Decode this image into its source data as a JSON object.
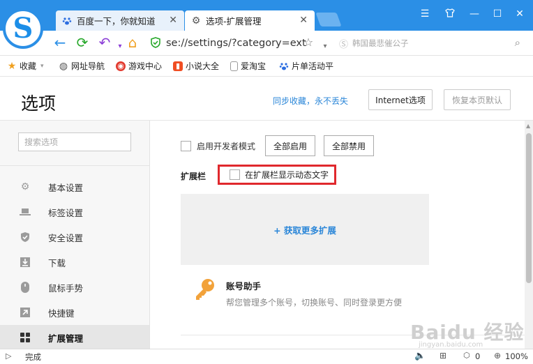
{
  "browser": {
    "logo_glyph": "S",
    "tabs": [
      {
        "label": "百度一下，你就知道",
        "icon": "paw-icon",
        "active": false
      },
      {
        "label": "选项-扩展管理",
        "icon": "gear-icon",
        "active": true
      }
    ],
    "address": "se://settings/?category=ext",
    "search_placeholder": "韩国最悲催公子",
    "bookmarks": [
      {
        "label": "收藏",
        "icon": "star-icon"
      },
      {
        "label": "网址导航",
        "icon": "globe-icon"
      },
      {
        "label": "游戏中心",
        "icon": "game-icon"
      },
      {
        "label": "小说大全",
        "icon": "book-icon"
      },
      {
        "label": "爱淘宝",
        "icon": "page-icon"
      },
      {
        "label": "片单活动平",
        "icon": "paw-icon"
      }
    ]
  },
  "header": {
    "title": "选项",
    "sync_link": "同步收藏，永不丢失",
    "internet_options": "Internet选项",
    "restore_default": "恢复本页默认"
  },
  "sidebar": {
    "search_placeholder": "搜索选项",
    "items": [
      {
        "label": "基本设置",
        "icon": "gear-icon"
      },
      {
        "label": "标签设置",
        "icon": "laptop-icon"
      },
      {
        "label": "安全设置",
        "icon": "shield-icon"
      },
      {
        "label": "下载",
        "icon": "download-icon"
      },
      {
        "label": "鼠标手势",
        "icon": "mouse-icon"
      },
      {
        "label": "快捷键",
        "icon": "shortcut-icon"
      },
      {
        "label": "扩展管理",
        "icon": "grid-icon",
        "active": true
      }
    ]
  },
  "main": {
    "dev_mode_label": "启用开发者模式",
    "enable_all": "全部启用",
    "disable_all": "全部禁用",
    "extbar_label": "扩展栏",
    "show_text_label": "在扩展栏显示动态文字",
    "get_more": "+ 获取更多扩展",
    "extension": {
      "name": "账号助手",
      "description": "帮您管理多个账号，切换账号、同时登录更方便"
    }
  },
  "status": {
    "text": "完成",
    "counter": "0",
    "zoom": "100%"
  },
  "watermark": {
    "text": "Baidu 经验",
    "sub": "jingyan.baidu.com"
  },
  "colors": {
    "titlebar": "#2b8fe6",
    "link": "#2a86d8",
    "highlight": "#e0282d"
  }
}
